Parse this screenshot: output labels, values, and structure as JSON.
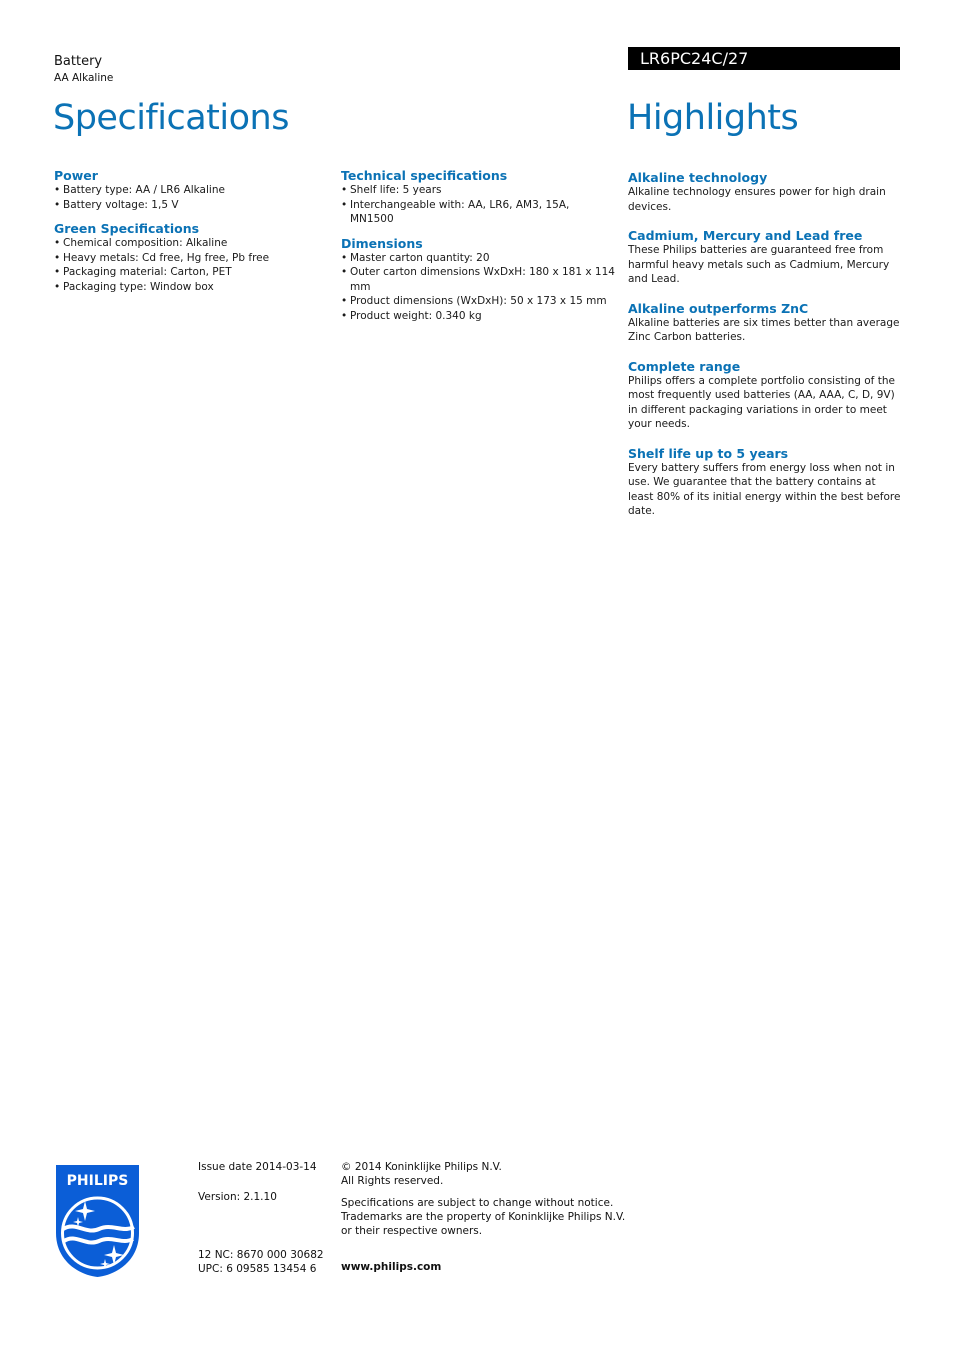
{
  "header": {
    "product_type": "Battery",
    "product_subtype": "AA Alkaline",
    "model_number": "LR6PC24C/27",
    "specifications_title": "Specifications",
    "highlights_title": "Highlights",
    "accent_color": "#0b72b5"
  },
  "specifications": {
    "power": {
      "heading": "Power",
      "items": [
        "Battery type: AA / LR6 Alkaline",
        "Battery voltage: 1,5 V"
      ]
    },
    "green": {
      "heading": "Green Specifications",
      "items": [
        "Chemical composition: Alkaline",
        "Heavy metals: Cd free, Hg free, Pb free",
        "Packaging material: Carton, PET",
        "Packaging type: Window box"
      ]
    },
    "technical": {
      "heading": "Technical specifications",
      "items": [
        "Shelf life: 5 years",
        "Interchangeable with: AA, LR6, AM3, 15A, MN1500"
      ]
    },
    "dimensions": {
      "heading": "Dimensions",
      "items": [
        "Master carton quantity: 20",
        "Outer carton dimensions WxDxH: 180 x 181 x 114 mm",
        "Product dimensions (WxDxH): 50 x 173 x 15 mm",
        "Product weight: 0.340 kg"
      ]
    }
  },
  "highlights": [
    {
      "heading": "Alkaline technology",
      "text": "Alkaline technology ensures power for high drain devices."
    },
    {
      "heading": "Cadmium, Mercury and Lead free",
      "text": "These Philips batteries are guaranteed free from harmful heavy metals such as Cadmium, Mercury and Lead."
    },
    {
      "heading": "Alkaline outperforms ZnC",
      "text": "Alkaline batteries are six times better than average Zinc Carbon batteries."
    },
    {
      "heading": "Complete range",
      "text": "Philips offers a complete portfolio consisting of the most frequently used batteries (AA, AAA, C, D, 9V) in different packaging variations in order to meet your needs."
    },
    {
      "heading": "Shelf life up to 5 years",
      "text": "Every battery suffers from energy loss when not in use. We guarantee that the battery contains at least 80% of its initial energy within the best before date."
    }
  ],
  "footer": {
    "logo_text": "PHILIPS",
    "issue_date": "Issue date 2014-03-14",
    "version": "Version: 2.1.10",
    "nc": "12 NC: 8670 000 30682",
    "upc": "UPC: 6 09585 13454 6",
    "copyright_line1": "© 2014 Koninklijke Philips N.V.",
    "copyright_line2": "All Rights reserved.",
    "notice_line1": "Specifications are subject to change without notice.",
    "notice_line2": "Trademarks are the property of Koninklijke Philips N.V.",
    "notice_line3": "or their respective owners.",
    "website": "www.philips.com"
  }
}
